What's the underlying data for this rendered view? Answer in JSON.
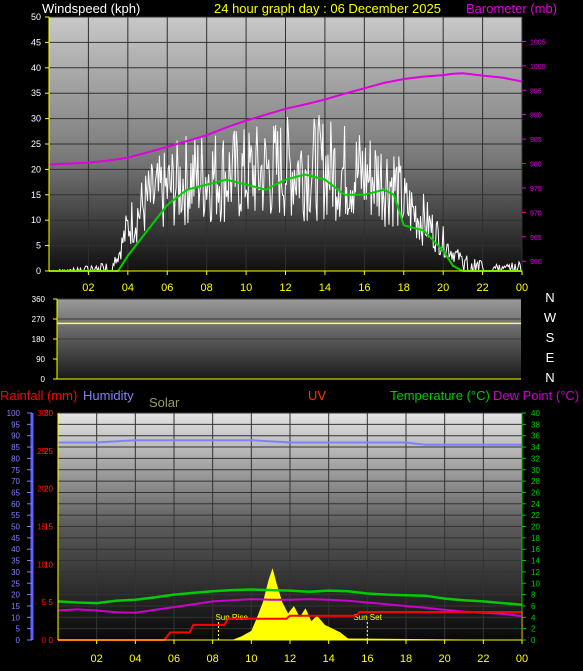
{
  "header": {
    "wind_title": "Windspeed (kph)",
    "graph_title": "24 hour graph day : 06 December 2025",
    "baro_title": "Barometer (mb)"
  },
  "colors": {
    "wind": "#ffffff",
    "gust_avg": "#00d000",
    "barometer": "#e000e0",
    "direction": "#ffff66",
    "rainfall": "#ff0000",
    "humidity": "#8080ff",
    "solar": "#ffff00",
    "uv": "#ff3300",
    "temperature": "#00cc00",
    "dewpoint": "#cc00cc",
    "axis_yellow": "#ffff00",
    "background": "#000000"
  },
  "panel3": {
    "rainfall_label": "Rainfall (mm)",
    "humidity_label": "Humidity",
    "solar_label": "Solar",
    "uv_label": "UV",
    "temperature_label": "Temperature (°C)",
    "dewpoint_label": "Dew Point (°C)",
    "sunrise_label": "Sun Rise",
    "sunset_label": "Sun Set"
  },
  "compass": [
    "N",
    "W",
    "S",
    "E",
    "N"
  ],
  "chart_data": [
    {
      "type": "line",
      "name": "windspeed-barometer",
      "x_ticks": [
        "02",
        "04",
        "06",
        "08",
        "10",
        "12",
        "14",
        "16",
        "18",
        "20",
        "22",
        "00"
      ],
      "ylabel": "Windspeed (kph)",
      "ylim": [
        0,
        50
      ],
      "y_ticks": [
        0,
        5,
        10,
        15,
        20,
        25,
        30,
        35,
        40,
        45,
        50
      ],
      "y2label": "Barometer (mb)",
      "y2lim": [
        958,
        1010
      ],
      "y2_ticks": [
        960,
        965,
        970,
        975,
        980,
        985,
        990,
        995,
        1000,
        1005
      ],
      "grid": true,
      "x_hours": [
        0,
        2,
        3,
        3.5,
        4,
        5,
        6,
        7,
        8,
        9,
        10,
        11,
        12,
        13,
        14,
        15,
        16,
        17,
        17.5,
        18,
        19,
        20,
        20.5,
        21,
        22,
        23,
        24
      ],
      "series": [
        {
          "name": "Windspeed (kph)",
          "values": [
            0,
            1,
            2,
            4,
            12,
            19,
            22,
            25,
            26,
            26,
            26,
            27,
            28,
            28,
            28,
            27,
            26,
            25,
            24,
            18,
            14,
            8,
            5,
            3,
            2,
            1,
            2
          ]
        },
        {
          "name": "Average",
          "values": [
            0,
            0,
            0,
            0,
            3,
            8,
            13,
            16,
            17,
            18,
            17,
            16,
            18,
            19,
            18,
            15,
            15,
            16,
            15,
            9,
            8,
            4,
            1,
            0,
            0,
            0,
            0
          ]
        },
        {
          "name": "Barometer (mb)",
          "values": [
            979.8,
            980.2,
            980.6,
            980.9,
            981.2,
            982.3,
            983.4,
            984.6,
            985.8,
            987.4,
            988.8,
            990.0,
            991.2,
            992.1,
            993.1,
            994.3,
            995.4,
            996.5,
            996.9,
            997.3,
            997.8,
            998.1,
            998.4,
            998.5,
            998.0,
            997.6,
            996.8
          ]
        }
      ]
    },
    {
      "type": "line",
      "name": "wind-direction",
      "ylim": [
        0,
        360
      ],
      "y_ticks": [
        0,
        90,
        180,
        270,
        360
      ],
      "x_hours": [
        0,
        24
      ],
      "values": [
        250,
        250
      ]
    },
    {
      "type": "line",
      "name": "rain-humidity-solar-uv-temperature-dewpoint",
      "x_ticks": [
        "02",
        "04",
        "06",
        "08",
        "10",
        "12",
        "14",
        "16",
        "18",
        "20",
        "22",
        "00"
      ],
      "humidity_ticks": [
        0,
        5,
        10,
        15,
        20,
        25,
        30,
        35,
        40,
        45,
        50,
        55,
        60,
        65,
        70,
        75,
        80,
        85,
        90,
        95,
        100
      ],
      "rain_ticks": [
        0,
        5,
        10,
        15,
        20,
        25,
        30
      ],
      "uv_ticks": [
        0,
        5,
        10,
        15,
        20,
        25,
        30
      ],
      "temp_ticks": [
        0,
        2,
        4,
        6,
        8,
        10,
        12,
        14,
        16,
        18,
        20,
        22,
        24,
        26,
        28,
        30,
        32,
        34,
        36,
        38,
        40
      ],
      "grid": true,
      "series": [
        {
          "name": "Humidity",
          "axis": "humidity_0_100",
          "x_hours": [
            0,
            2,
            4,
            6,
            8,
            10,
            12,
            13,
            14,
            16,
            18,
            19,
            20,
            22,
            24
          ],
          "values": [
            87,
            87,
            88,
            88,
            88,
            88,
            87,
            87,
            87,
            87,
            87,
            86,
            86,
            86,
            86
          ]
        },
        {
          "name": "Temperature (°C)",
          "axis": "temp_0_40",
          "x_hours": [
            0,
            1,
            2,
            3,
            4,
            5,
            6,
            7,
            8,
            9,
            10,
            11,
            12,
            13,
            14,
            15,
            16,
            17,
            18,
            19,
            20,
            21,
            22,
            23,
            24
          ],
          "values": [
            6.8,
            6.6,
            6.5,
            6.9,
            7.1,
            7.5,
            8.0,
            8.3,
            8.6,
            8.8,
            8.9,
            8.8,
            8.7,
            8.5,
            8.7,
            8.6,
            8.2,
            8.0,
            7.9,
            7.8,
            7.3,
            7.0,
            6.8,
            6.5,
            6.2
          ]
        },
        {
          "name": "Dew Point (°C)",
          "axis": "temp_0_40",
          "x_hours": [
            0,
            1,
            2,
            3,
            4,
            5,
            6,
            7,
            8,
            9,
            10,
            11,
            12,
            13,
            14,
            15,
            16,
            17,
            18,
            19,
            20,
            21,
            22,
            23,
            24
          ],
          "values": [
            5.2,
            5.4,
            5.2,
            4.9,
            4.8,
            5.3,
            5.8,
            6.3,
            6.8,
            7.0,
            7.2,
            7.1,
            7.1,
            7.2,
            7.1,
            6.9,
            6.6,
            6.3,
            6.0,
            5.7,
            5.3,
            5.0,
            4.8,
            4.6,
            4.2
          ]
        },
        {
          "name": "Rainfall (mm)",
          "axis": "rain_0_30",
          "x_hours": [
            0,
            5.5,
            5.8,
            6.8,
            7.0,
            8.6,
            8.8,
            11.8,
            12.0,
            15.4,
            15.6,
            24,
            24.01
          ],
          "values": [
            0,
            0,
            1.0,
            1.0,
            2.0,
            2.0,
            2.8,
            2.8,
            3.2,
            3.2,
            3.7,
            3.7,
            0
          ]
        },
        {
          "name": "Solar",
          "axis": "rain_0_30",
          "x_hours": [
            0,
            9.0,
            9.5,
            10.0,
            10.3,
            10.6,
            10.9,
            11.1,
            11.3,
            11.6,
            11.9,
            12.2,
            12.5,
            12.8,
            13.1,
            13.4,
            13.8,
            14.2,
            14.6,
            15.0,
            24
          ],
          "values": [
            0,
            0,
            0.5,
            1.2,
            3.0,
            5.0,
            8.0,
            9.5,
            7.5,
            5.0,
            3.5,
            4.5,
            3.0,
            4.2,
            2.5,
            3.2,
            2.0,
            1.5,
            1.0,
            0.2,
            0
          ]
        }
      ],
      "events": [
        {
          "label": "Sun Rise",
          "hour": 8.3
        },
        {
          "label": "Sun Set",
          "hour": 16.0
        }
      ]
    }
  ]
}
